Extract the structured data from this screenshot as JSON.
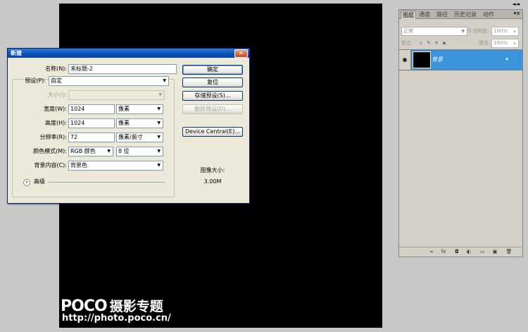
{
  "dialog": {
    "title": "新建",
    "close": "✕",
    "name_label": "名称(N):",
    "name_value": "未标题-2",
    "preset_label": "预设(P):",
    "preset_value": "自定",
    "size_label": "大小(I):",
    "width_label": "宽度(W):",
    "width_value": "1024",
    "width_unit": "像素",
    "height_label": "高度(H):",
    "height_value": "1024",
    "height_unit": "像素",
    "resolution_label": "分辨率(R):",
    "resolution_value": "72",
    "resolution_unit": "像素/英寸",
    "color_mode_label": "颜色模式(M):",
    "color_mode_value": "RGB 颜色",
    "bit_depth_value": "8 位",
    "background_label": "背景内容(C):",
    "background_value": "背景色",
    "advanced_label": "高级",
    "buttons": {
      "ok": "确定",
      "reset": "复位",
      "save_preset": "存储预设(S)...",
      "delete_preset": "删除预设(D)...",
      "device_central": "Device Central(E)..."
    },
    "image_size_label": "图像大小:",
    "image_size_value": "3.00M"
  },
  "layers_panel": {
    "collapse": "◄◄",
    "tabs": [
      "图层",
      "通道",
      "路径",
      "历史记录",
      "动作"
    ],
    "menu": "▾≡",
    "blend_mode": "正常",
    "opacity_label": "不透明度:",
    "opacity_value": "100%",
    "lock_label": "锁定:",
    "fill_label": "填充:",
    "fill_value": "100%",
    "layer_name": "背景"
  },
  "watermark": {
    "logo": "POCO",
    "logo_cn": "摄影专题",
    "url": "http://photo.poco.cn/"
  },
  "colors": {
    "canvas": "#000000",
    "workspace": "#c8c8c8",
    "dialog_bg": "#ece9d8",
    "titlebar": "#0a4fb8",
    "layer_selected": "#3b94d9"
  }
}
